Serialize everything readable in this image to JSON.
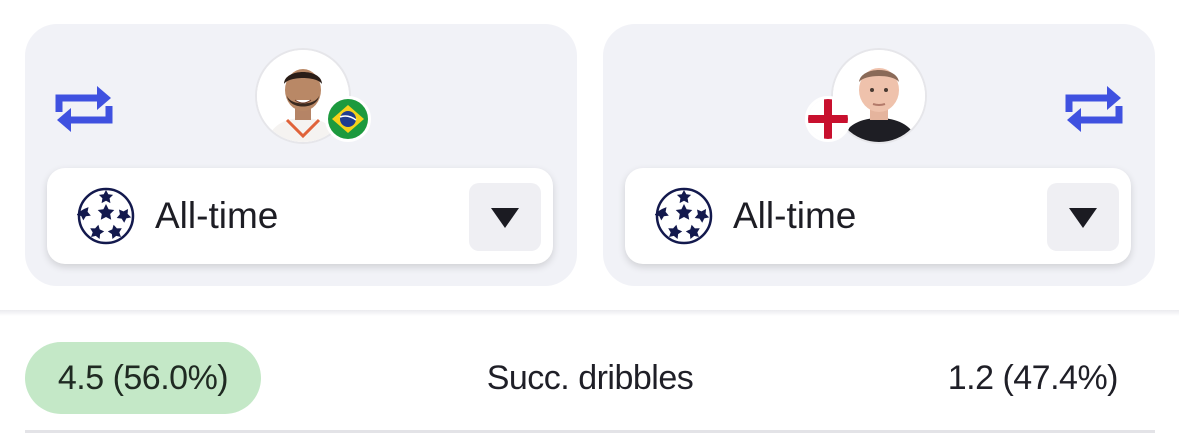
{
  "accent_color": "#3f51e0",
  "left_player": {
    "flag_icon": "brazil-flag-icon",
    "season_selector": {
      "league_icon": "champions-league-icon",
      "label": "All-time",
      "dropdown_icon": "caret-down-icon"
    },
    "swap_icon": "swap-icon"
  },
  "right_player": {
    "flag_icon": "england-flag-icon",
    "season_selector": {
      "league_icon": "champions-league-icon",
      "label": "All-time",
      "dropdown_icon": "caret-down-icon"
    },
    "swap_icon": "swap-icon"
  },
  "stat": {
    "name": "Succ. dribbles",
    "left_value": "4.5 (56.0%)",
    "right_value": "1.2 (47.4%)",
    "leader_highlight_color": "#c4e8c7"
  }
}
